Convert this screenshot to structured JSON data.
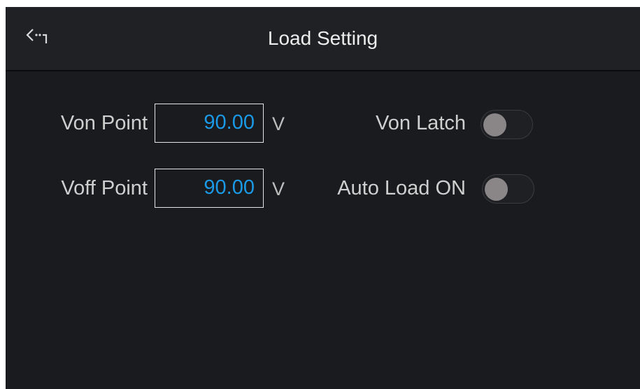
{
  "header": {
    "title": "Load Setting",
    "back_icon": "back-arrow-icon"
  },
  "settings": {
    "von_point": {
      "label": "Von Point",
      "value": "90.00",
      "unit": "V"
    },
    "voff_point": {
      "label": "Voff Point",
      "value": "90.00",
      "unit": "V"
    },
    "von_latch": {
      "label": "Von Latch",
      "state": false
    },
    "auto_load_on": {
      "label": "Auto Load ON",
      "state": false
    }
  },
  "colors": {
    "background": "#1a1b1f",
    "header": "#202125",
    "value_text": "#1a9ae6",
    "toggle_knob_off": "#8a8687"
  }
}
